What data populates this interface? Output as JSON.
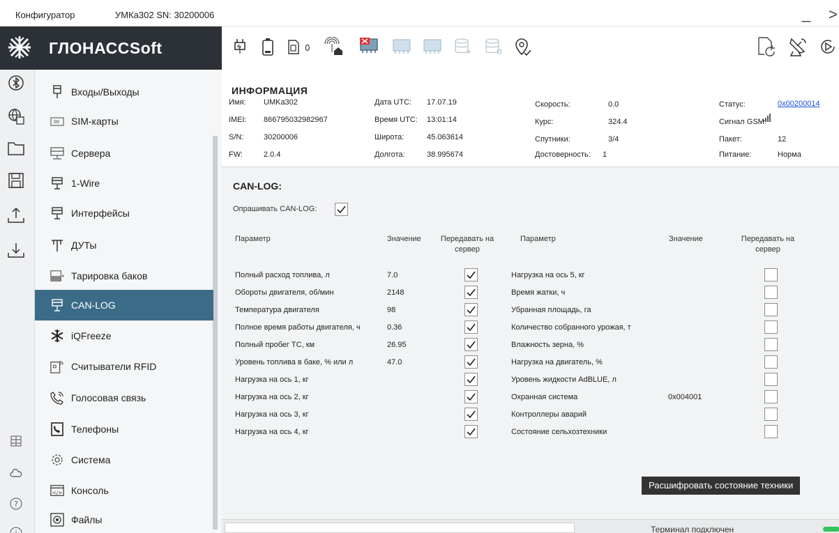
{
  "window": {
    "app": "Конфигуратор",
    "device": "УМКа302 SN: 30200006",
    "minimize": "_",
    "close": ">"
  },
  "brand": {
    "name": "ГЛОНАССSoft"
  },
  "rail": {
    "icons": [
      "bluetooth-icon",
      "globe-settings-icon",
      "folder-icon",
      "save-icon",
      "upload-icon",
      "download-icon",
      "grid-icon",
      "cloud-icon",
      "help-icon",
      "info-icon"
    ]
  },
  "nav": {
    "items": [
      {
        "label": "Входы/Выходы",
        "icon": "io-plug-icon"
      },
      {
        "label": "SIM-карты",
        "icon": "sim-card-icon"
      },
      {
        "label": "Сервера",
        "icon": "server-icon"
      },
      {
        "label": "1-Wire",
        "icon": "connector-icon"
      },
      {
        "label": "Интерфейсы",
        "icon": "connector-icon"
      },
      {
        "label": "ДУТы",
        "icon": "fuel-sensor-icon"
      },
      {
        "label": "Тарировка баков",
        "icon": "tank-icon"
      },
      {
        "label": "CAN-LOG",
        "icon": "connector-icon"
      },
      {
        "label": "iQFreeze",
        "icon": "snowflake-icon"
      },
      {
        "label": "Считыватели RFID",
        "icon": "rfid-icon"
      },
      {
        "label": "Голосовая связь",
        "icon": "phone-call-icon"
      },
      {
        "label": "Телефоны",
        "icon": "phone-book-icon"
      },
      {
        "label": "Система",
        "icon": "gear-icon"
      },
      {
        "label": "Консоль",
        "icon": "console-icon"
      },
      {
        "label": "Файлы",
        "icon": "files-icon"
      }
    ],
    "active_index": 7
  },
  "toolbar": {
    "left": [
      "plug-icon",
      "battery-icon",
      "sim-zero-icon",
      "home-signal-icon",
      "chip-error-icon",
      "chip-disabled-icon",
      "chip-disabled-icon",
      "database-disabled-icon",
      "database-settings-disabled-icon",
      "location-check-icon"
    ],
    "right": [
      "refresh-doc-icon",
      "satellite-dish-icon",
      "play-circle-icon"
    ]
  },
  "info": {
    "heading": "ИНФОРМАЦИЯ",
    "col1": [
      {
        "label": "Имя:",
        "value": "UMKa302"
      },
      {
        "label": "IMEI:",
        "value": "866795032982967"
      },
      {
        "label": "S/N:",
        "value": "30200006"
      },
      {
        "label": "FW:",
        "value": "2.0.4"
      }
    ],
    "col2": [
      {
        "label": "Дата UTC:",
        "value": "17.07.19"
      },
      {
        "label": "Время UTC:",
        "value": "13:01:14"
      },
      {
        "label": "Широта:",
        "value": "45.063614"
      },
      {
        "label": "Долгота:",
        "value": "38.995674"
      }
    ],
    "col3": [
      {
        "label": "Скорость:",
        "value": "0.0"
      },
      {
        "label": "Курс:",
        "value": "324.4"
      },
      {
        "label": "Спутники:",
        "value": "3/4"
      },
      {
        "label": "Достоверность:",
        "value": "1"
      }
    ],
    "col4": [
      {
        "label": "Статус:",
        "value": "0x00200014"
      },
      {
        "label": "Сигнал GSM:",
        "value": ""
      },
      {
        "label": "Пакет:",
        "value": "12"
      },
      {
        "label": "Питание:",
        "value": "Норма"
      }
    ]
  },
  "canlog": {
    "title": "CAN-LOG:",
    "poll_label": "Опрашивать CAN-LOG:",
    "poll_checked": true,
    "headers": {
      "param": "Параметр",
      "value": "Значение",
      "send_line1": "Передавать на",
      "send_line2": "сервер"
    },
    "left_rows": [
      {
        "param": "Полный расход топлива, л",
        "value": "7.0",
        "send": true
      },
      {
        "param": "Обороты двигателя, об/мин",
        "value": "2148",
        "send": true
      },
      {
        "param": "Температура двигателя",
        "value": "98",
        "send": true
      },
      {
        "param": "Полное время работы двигателя, ч",
        "value": "0.36",
        "send": true
      },
      {
        "param": "Полный пробег ТС, км",
        "value": "26.95",
        "send": true
      },
      {
        "param": "Уровень топлива в баке, % или л",
        "value": "47.0",
        "send": true
      },
      {
        "param": "Нагрузка на ось 1, кг",
        "value": "",
        "send": true
      },
      {
        "param": "Нагрузка на ось 2, кг",
        "value": "",
        "send": true
      },
      {
        "param": "Нагрузка на ось 3, кг",
        "value": "",
        "send": true
      },
      {
        "param": "Нагрузка на ось 4, кг",
        "value": "",
        "send": true
      }
    ],
    "right_rows": [
      {
        "param": "Нагрузка на ось 5, кг",
        "value": "",
        "send": false
      },
      {
        "param": "Время жатки, ч",
        "value": "",
        "send": false
      },
      {
        "param": "Убранная площадь, га",
        "value": "",
        "send": false
      },
      {
        "param": "Количество собранного урожая, т",
        "value": "",
        "send": false
      },
      {
        "param": "Влажность зерна, %",
        "value": "",
        "send": false
      },
      {
        "param": "Нагрузка на двигатель, %",
        "value": "",
        "send": false
      },
      {
        "param": "Уровень жидкости AdBLUE, л",
        "value": "",
        "send": false
      },
      {
        "param": "Охранная система",
        "value": "0x004001",
        "send": false
      },
      {
        "param": "Контроллеры аварий",
        "value": "",
        "send": false
      },
      {
        "param": "Состояние сельхозтехники",
        "value": "",
        "send": false
      }
    ],
    "tooltip": "Расшифровать состояние техники"
  },
  "status": {
    "text": "Терминал подключен",
    "color": "#36c45a"
  }
}
